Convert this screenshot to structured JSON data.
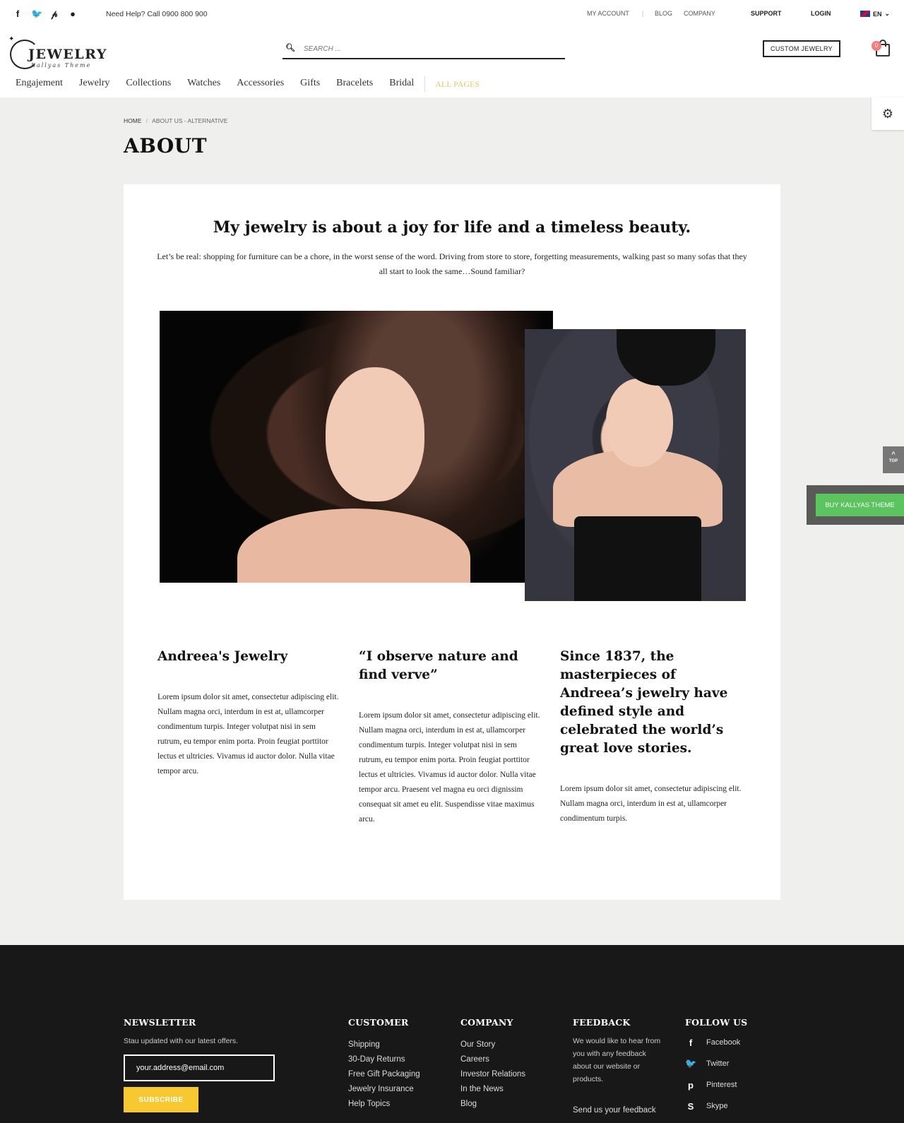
{
  "topbar": {
    "help_text": "Need Help? Call 0900 800 900",
    "my_account": "MY ACCOUNT",
    "divider": "|",
    "blog": "BLOG",
    "company": "COMPANY",
    "support": "SUPPORT",
    "login": "LOGIN",
    "language": "EN"
  },
  "logo": {
    "title": "JEWELRY",
    "subtitle": "Kallyas Theme"
  },
  "search": {
    "placeholder": "SEARCH ..."
  },
  "header": {
    "custom_button": "CUSTOM JEWELRY",
    "cart_count": "0"
  },
  "nav": {
    "items": [
      "Engajement",
      "Jewelry",
      "Collections",
      "Watches",
      "Accessories",
      "Gifts",
      "Bracelets",
      "Bridal"
    ],
    "all_pages": "ALL PAGES"
  },
  "side": {
    "top_label": "TOP",
    "buy_label": "BUY KALLYAS THEME"
  },
  "breadcrumb": {
    "home": "HOME",
    "separator": "/",
    "current": "ABOUT US - ALTERNATIVE"
  },
  "page_title": "ABOUT",
  "main": {
    "headline": "My jewelry is about a joy for life and a timeless beauty.",
    "intro": "Let’s be real: shopping for furniture can be a chore, in the worst sense of the word. Driving from store to store, forgetting measurements, walking past so many sofas that they all start to look the same…Sound familiar?",
    "columns": [
      {
        "title": "Andreea's Jewelry",
        "text": "Lorem ipsum dolor sit amet, consectetur adipiscing elit. Nullam magna orci, interdum in est at, ullamcorper condimentum turpis. Integer volutpat nisi in sem rutrum, eu tempor enim porta. Proin feugiat porttitor lectus et ultricies. Vivamus id auctor dolor. Nulla vitae tempor arcu."
      },
      {
        "title": "“I observe nature and find verve”",
        "text": "Lorem ipsum dolor sit amet, consectetur adipiscing elit. Nullam magna orci, interdum in est at, ullamcorper condimentum turpis. Integer volutpat nisi in sem rutrum, eu tempor enim porta. Proin feugiat porttitor lectus et ultricies. Vivamus id auctor dolor. Nulla vitae tempor arcu. Praesent vel magna eu orci dignissim consequat sit amet eu elit. Suspendisse vitae maximus arcu."
      },
      {
        "title": "Since 1837, the masterpieces of Andreea’s jewelry have defined style and celebrated the world’s great love stories.",
        "text": "Lorem ipsum dolor sit amet, consectetur adipiscing elit. Nullam magna orci, interdum in est at, ullamcorper condimentum turpis."
      }
    ]
  },
  "footer": {
    "newsletter": {
      "title": "NEWSLETTER",
      "text": "Stau updated with our latest offers.",
      "input_value": "your.address@email.com",
      "button": "SUBSCRIBE"
    },
    "customer": {
      "title": "CUSTOMER",
      "links": [
        "Shipping",
        "30-Day Returns",
        "Free Gift Packaging",
        "Jewelry Insurance",
        "Help Topics"
      ]
    },
    "company": {
      "title": "COMPANY",
      "links": [
        "Our Story",
        "Careers",
        "Investor Relations",
        "In the News",
        "Blog"
      ]
    },
    "feedback": {
      "title": "FEEDBACK",
      "text": "We would like to hear from you with any feedback about our website or products.",
      "link": "Send us your feedback"
    },
    "follow": {
      "title": "FOLLOW US",
      "links": [
        "Facebook",
        "Twitter",
        "Pinterest",
        "Skype"
      ]
    }
  },
  "colors": {
    "accent_gold": "#e8c56a",
    "subscribe_yellow": "#f7c830",
    "buy_green": "#5bc45f",
    "cart_badge": "#f57c7c",
    "footer_bg": "#181818"
  }
}
